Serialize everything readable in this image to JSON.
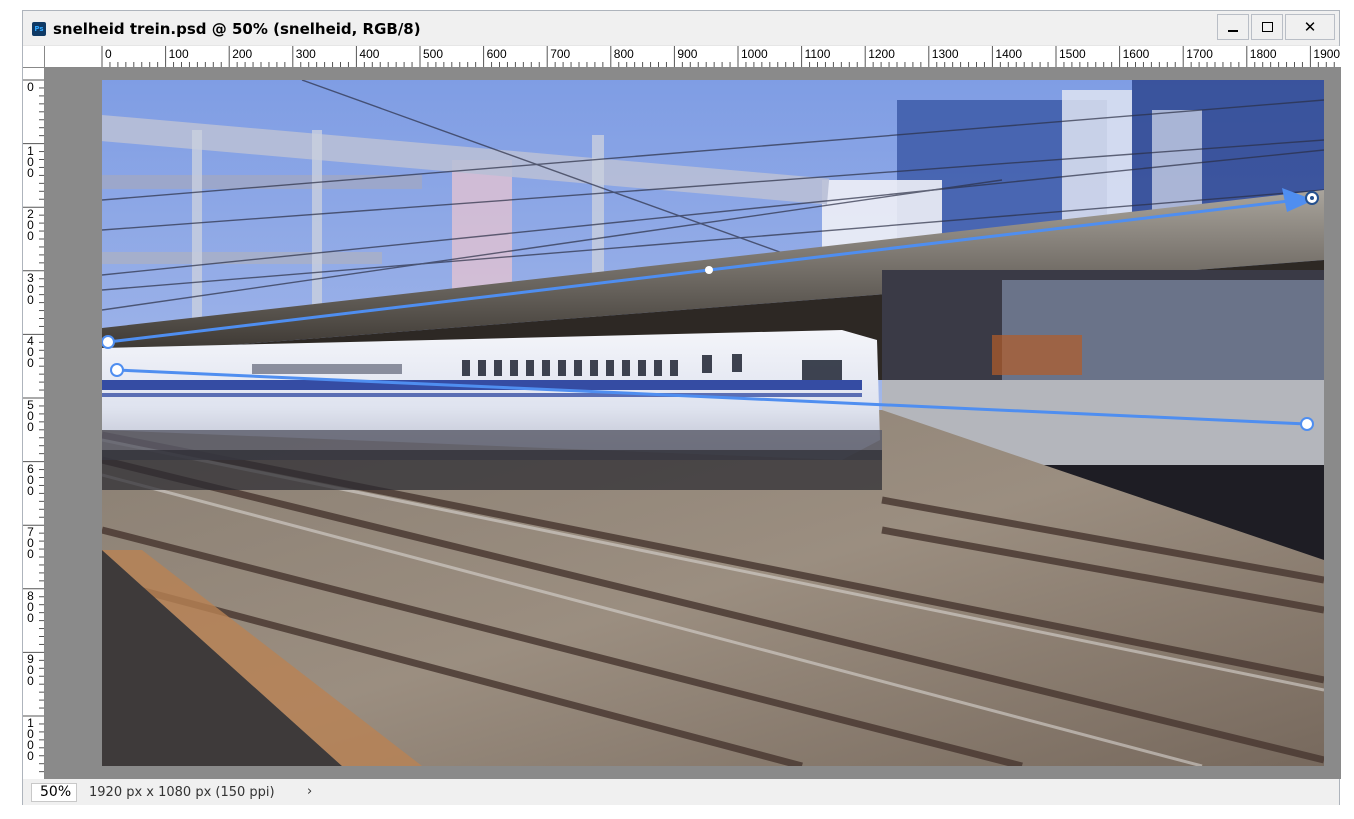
{
  "window": {
    "title": "snelheid trein.psd @ 50% (snelheid, RGB/8)",
    "app_icon_text": "Ps",
    "minimize_glyph": "",
    "maximize_glyph": "",
    "close_glyph": "✕"
  },
  "rulers": {
    "horizontal": [
      "0",
      "100",
      "200",
      "300",
      "400",
      "500",
      "600",
      "700",
      "800",
      "900",
      "1000",
      "1100",
      "1200",
      "1300",
      "1400",
      "1500",
      "1600",
      "1700",
      "1800",
      "1900"
    ],
    "vertical": [
      "0",
      "100",
      "200",
      "300",
      "400",
      "500",
      "600",
      "700",
      "800",
      "900",
      "1000"
    ]
  },
  "status": {
    "zoom": "50%",
    "doc_info": "1920 px x 1080 px (150 ppi)",
    "chevron": "›"
  },
  "colors": {
    "path_blue": "#4f8ef0",
    "ps_dark": "#0f3a66",
    "ps_accent": "#31a8ff",
    "pasteboard": "#8a8a8a"
  },
  "icons": [
    "photoshop-icon",
    "minimize-icon",
    "maximize-icon",
    "close-icon",
    "chevron-right-icon"
  ]
}
